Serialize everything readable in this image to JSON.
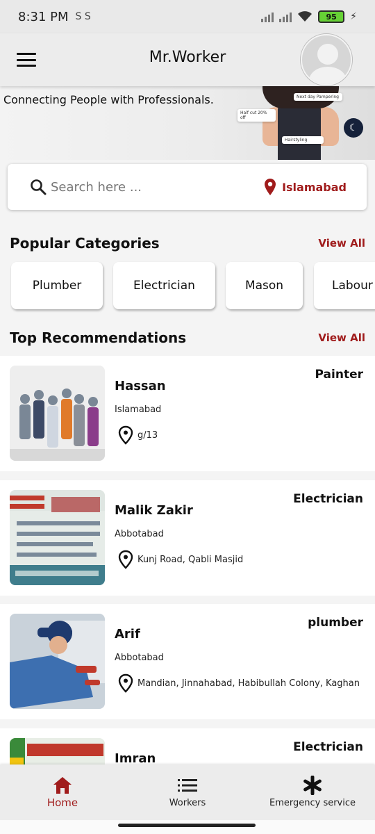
{
  "status": {
    "time": "8:31 PM",
    "sim_icons": "S S",
    "battery": "95"
  },
  "app_bar": {
    "title": "Mr.Worker"
  },
  "hero": {
    "tagline": "Connecting People with Professionals.",
    "card_1": "Next day Pampering",
    "card_2": "Half cut 20% off",
    "card_3": "Hairstyling"
  },
  "search": {
    "placeholder": "Search here ...",
    "location": "Islamabad"
  },
  "categories": {
    "title": "Popular Categories",
    "view_all": "View All",
    "items": [
      "Plumber",
      "Electrician",
      "Mason",
      "Labour"
    ]
  },
  "recommendations": {
    "title": "Top Recommendations",
    "view_all": "View All",
    "items": [
      {
        "name": "Hassan",
        "city": "Islamabad",
        "address": "g/13",
        "profession": "Painter"
      },
      {
        "name": "Malik Zakir",
        "city": "Abbotabad",
        "address": "Kunj Road, Qabli Masjid",
        "profession": "Electrician"
      },
      {
        "name": "Arif",
        "city": "Abbotabad",
        "address": "Mandian, Jinnahabad, Habibullah Colony, Kaghan",
        "profession": "plumber"
      },
      {
        "name": "Imran",
        "city": "",
        "address": "",
        "profession": "Electrician"
      }
    ]
  },
  "bottom_nav": {
    "items": [
      "Home",
      "Workers",
      "Emergency service"
    ]
  },
  "colors": {
    "accent": "#a01c1c",
    "background": "#f4f4f4",
    "card": "#ffffff"
  }
}
